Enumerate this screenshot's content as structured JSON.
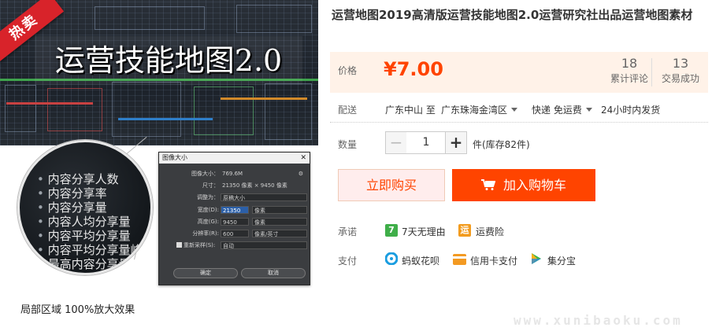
{
  "product_image": {
    "hot_badge": "热卖",
    "banner_title": "运营技能地图2.0",
    "magnified_items": [
      "内容分享人数",
      "内容分享率",
      "内容分享量",
      "内容人均分享量",
      "内容平均分享量",
      "内容平均分享量峰",
      "最高内容分享量"
    ],
    "zoom_caption": "局部区域 100%放大效果",
    "dialog": {
      "title": "图像大小",
      "close": "✕",
      "image_size_label": "图像大小：",
      "image_size_value": "769.6M",
      "dimensions_label": "尺寸：",
      "dimensions_value": "21350 像素 × 9450 像素",
      "adjust_label": "调整为：",
      "adjust_value": "原稿大小",
      "width_label": "宽度(D):",
      "width_value": "21350",
      "width_unit": "像素",
      "height_label": "高度(G):",
      "height_value": "9450",
      "height_unit": "像素",
      "resolution_label": "分辨率(R):",
      "resolution_value": "600",
      "resolution_unit": "像素/英寸",
      "resample_label": "重新采样(S):",
      "resample_value": "自动",
      "ok_label": "确定",
      "cancel_label": "取消"
    }
  },
  "product": {
    "title": "运营地图2019高清版运营技能地图2.0运营研究社出品运营地图素材"
  },
  "price": {
    "label": "价格",
    "value": "¥7.00",
    "reviews_count": "18",
    "reviews_label": "累计评论",
    "deals_count": "13",
    "deals_label": "交易成功"
  },
  "shipping": {
    "label": "配送",
    "from": "广东中山 至",
    "to": "广东珠海金湾区",
    "method": "快递 免运费",
    "dispatch": "24小时内发货"
  },
  "quantity": {
    "label": "数量",
    "minus": "−",
    "value": "1",
    "plus": "+",
    "stock": "件(库存82件)"
  },
  "actions": {
    "buy_now": "立即购买",
    "add_to_cart": "加入购物车"
  },
  "promise": {
    "label": "承诺",
    "return_icon_text": "7",
    "return_text": "7天无理由",
    "freight_icon_text": "运",
    "freight_text": "运费险"
  },
  "payment": {
    "label": "支付",
    "methods": [
      "蚂蚁花呗",
      "信用卡支付",
      "集分宝"
    ]
  },
  "watermark": "www.xunibaoku.com",
  "colors": {
    "accent": "#ff4400",
    "price_bg": "#fff2e8",
    "hot_badge": "#d8232a"
  }
}
